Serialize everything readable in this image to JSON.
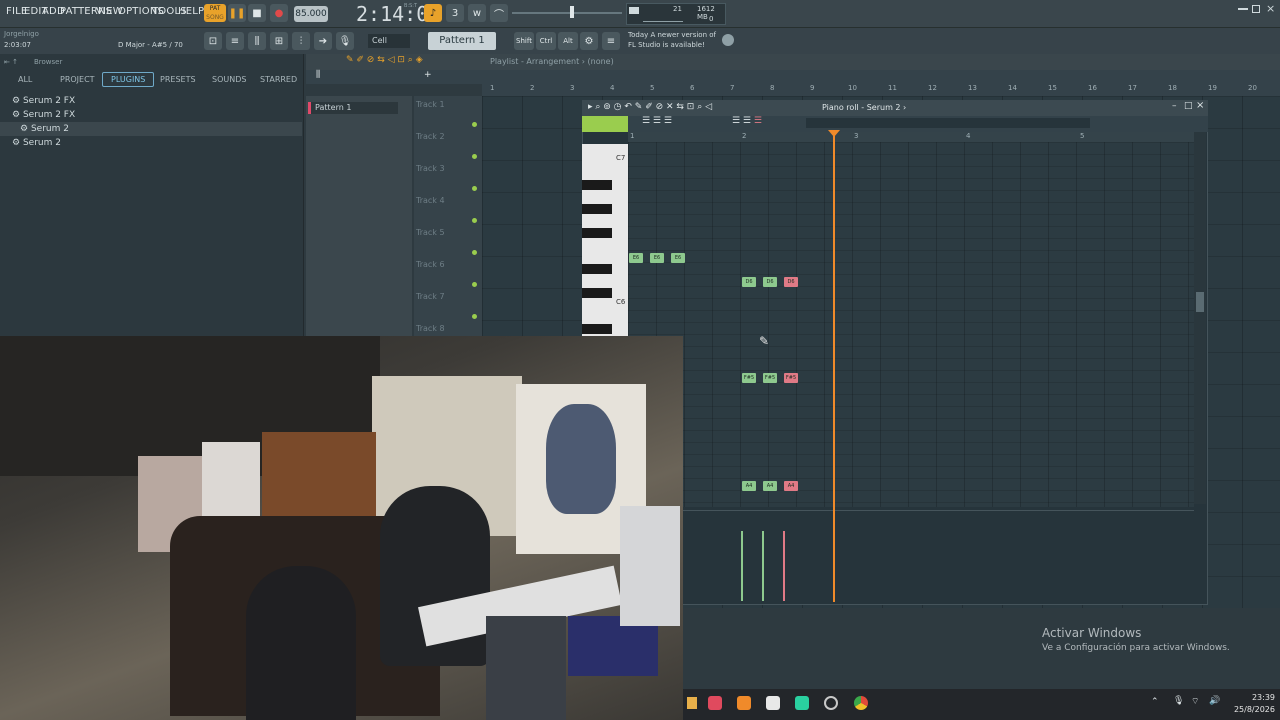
{
  "menu": [
    "FILE",
    "EDIT",
    "ADD",
    "PATTERNS",
    "VIEW",
    "OPTIONS",
    "TOOLS",
    "HELP"
  ],
  "pat_label": "PAT",
  "song_label": "SONG",
  "tempo": "85.000",
  "time": "2:14:04",
  "time_small": "B:S:T",
  "cpu": "21",
  "mem": "1612 MB",
  "poly": "0",
  "project_user": "Jorgelnigo",
  "project_time": "2:03:07",
  "key_info": "D Major - A#5 / 70",
  "snap": "Cell",
  "pattern": "Pattern 1",
  "keys": [
    "Shift",
    "Ctrl",
    "Alt"
  ],
  "news": {
    "line1": "Today  A newer version of",
    "line2": "FL Studio is available!"
  },
  "browser": {
    "title": "Browser",
    "tabs": [
      "ALL",
      "PROJECT",
      "PLUGINS",
      "PRESETS",
      "SOUNDS",
      "STARRED"
    ],
    "active_tab": "PLUGINS",
    "items": [
      "Serum 2 FX",
      "Serum 2 FX",
      "Serum 2",
      "Serum 2"
    ]
  },
  "channel": {
    "pattern_label": "Pattern 1"
  },
  "playlist": {
    "title": "Playlist - Arrangement › (none)",
    "tracks": [
      "Track 1",
      "Track 2",
      "Track 3",
      "Track 4",
      "Track 5",
      "Track 6",
      "Track 7",
      "Track 8"
    ],
    "ruler": [
      "1",
      "2",
      "3",
      "4",
      "5",
      "6",
      "7",
      "8",
      "9",
      "10",
      "11",
      "12",
      "13",
      "14",
      "15",
      "16",
      "17",
      "18",
      "19",
      "20"
    ]
  },
  "piano_roll": {
    "title": "Piano roll - Serum 2 ›",
    "ruler": [
      "1",
      "2",
      "3",
      "4",
      "5"
    ],
    "key_labels": [
      "C7",
      "C6"
    ],
    "notes": [
      {
        "label": "E6",
        "color": "g"
      },
      {
        "label": "E6",
        "color": "g"
      },
      {
        "label": "E6",
        "color": "g"
      },
      {
        "label": "D6",
        "color": "g"
      },
      {
        "label": "D6",
        "color": "g"
      },
      {
        "label": "D6",
        "color": "r"
      },
      {
        "label": "F#5",
        "color": "g"
      },
      {
        "label": "F#5",
        "color": "g"
      },
      {
        "label": "F#5",
        "color": "r"
      },
      {
        "label": "A4",
        "color": "g"
      },
      {
        "label": "A4",
        "color": "g"
      },
      {
        "label": "A4",
        "color": "r"
      }
    ]
  },
  "watermark": {
    "title": "Activar Windows",
    "subtitle": "Ve a Configuración para activar Windows."
  },
  "tray": {
    "time": "23:39",
    "date": "25/8/2026"
  }
}
